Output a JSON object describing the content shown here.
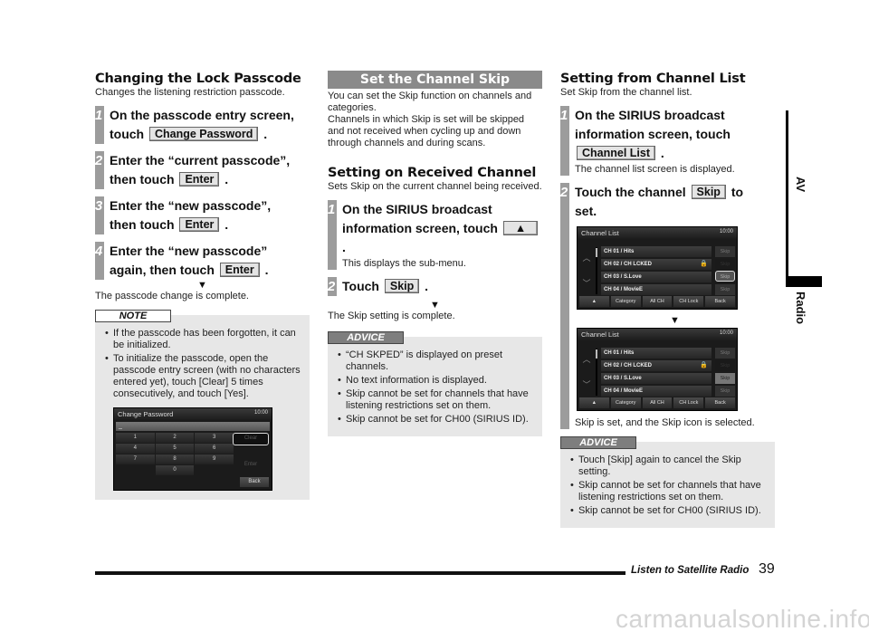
{
  "col1": {
    "heading": "Changing the Lock Passcode",
    "intro": "Changes the listening restriction passcode.",
    "steps": [
      {
        "num": "1",
        "text_a": "On the passcode entry screen,",
        "text_b": "touch",
        "key": "Change Password",
        "tail": "."
      },
      {
        "num": "2",
        "text_a": "Enter the “current passcode”,",
        "text_b": "then touch",
        "key": "Enter",
        "tail": "."
      },
      {
        "num": "3",
        "text_a": "Enter the “new passcode”,",
        "text_b": "then touch",
        "key": "Enter",
        "tail": "."
      },
      {
        "num": "4",
        "text_a": "Enter the “new passcode”",
        "text_b": "again, then touch",
        "key": "Enter",
        "tail": "."
      }
    ],
    "arrow": "▼",
    "result": "The passcode change is complete.",
    "note": {
      "label": "NOTE",
      "bullets": [
        "If the passcode has been forgotten, it can be initialized.",
        "To initialize the passcode, open the passcode entry screen (with no characters entered yet), touch [Clear] 5 times consecutively, and touch [Yes]."
      ],
      "screen": {
        "title": "Change Password",
        "time": "10:00",
        "input": "_",
        "keys": [
          "1",
          "2",
          "3",
          "4",
          "5",
          "6",
          "7",
          "8",
          "9",
          "",
          "0",
          ""
        ],
        "clear": "Clear",
        "enter": "Enter",
        "back": "Back"
      }
    }
  },
  "col2": {
    "banner": "Set the Channel Skip",
    "intro_1": "You can set the Skip function on channels and categories.",
    "intro_2": "Channels in which Skip is set will be skipped and not received when cycling up and down through channels and during scans.",
    "heading": "Setting on Received Channel",
    "heading_intro": "Sets Skip on the current channel being received.",
    "steps": [
      {
        "num": "1",
        "text_a": "On the SIRIUS broadcast",
        "text_b": "information screen, touch",
        "key": "▲",
        "tail": ".",
        "sub": "This displays the sub-menu."
      },
      {
        "num": "2",
        "text_b": "Touch",
        "key": "Skip",
        "tail": "."
      }
    ],
    "arrow": "▼",
    "result": "The Skip setting is complete.",
    "advice": {
      "label": "ADVICE",
      "bullets": [
        "“CH SKPED” is displayed on preset channels.",
        "No text information is displayed.",
        "Skip cannot be set for channels that have listening restrictions set on them.",
        "Skip cannot be set for CH00 (SIRIUS ID)."
      ]
    }
  },
  "col3": {
    "heading": "Setting from Channel List",
    "intro": "Set Skip from the channel list.",
    "steps": [
      {
        "num": "1",
        "text_a": "On the SIRIUS broadcast",
        "text_b": "information screen, touch",
        "key": "Channel List",
        "tail": ".",
        "sub": "The channel list screen is displayed."
      },
      {
        "num": "2",
        "text_a": "Touch the channel",
        "key": "Skip",
        "text_c": "to",
        "text_d": "set.",
        "sub": "Skip is set, and the Skip icon is selected."
      }
    ],
    "arrow": "▼",
    "screen": {
      "title": "Channel  List",
      "time": "10:00",
      "rows": [
        "CH 01 / Hits",
        "CH 02 / CH LCKED",
        "CH 03 / S.Love",
        "CH 04 / MovieE"
      ],
      "skip": "Skip",
      "footer": [
        "▲",
        "Category",
        "All CH",
        "CH Lock",
        "Back"
      ]
    },
    "advice": {
      "label": "ADVICE",
      "bullets": [
        "Touch [Skip] again to cancel the Skip setting.",
        "Skip cannot be set for channels that have listening restrictions set on them.",
        "Skip cannot be set for CH00 (SIRIUS ID)."
      ]
    }
  },
  "side": {
    "av": "AV",
    "radio": "Radio"
  },
  "footer": {
    "title": "Listen to Satellite Radio",
    "page": "39",
    "watermark": "carmanualsonline.info"
  }
}
